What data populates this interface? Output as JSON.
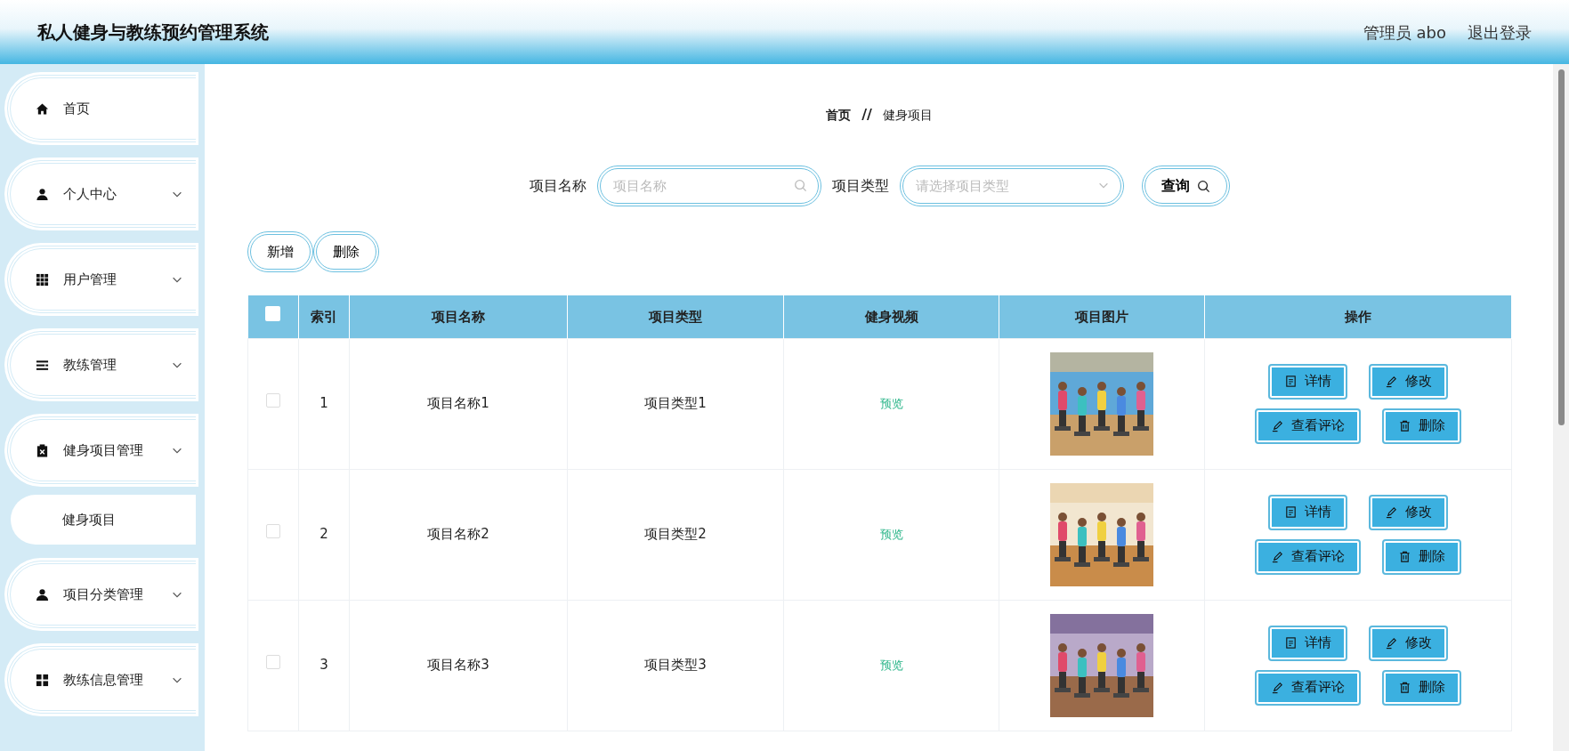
{
  "header": {
    "title": "私人健身与教练预约管理系统",
    "user": "管理员 abo",
    "logout": "退出登录"
  },
  "sidebar": {
    "items": [
      {
        "label": "首页",
        "kind": "link"
      },
      {
        "label": "个人中心",
        "kind": "submenu"
      },
      {
        "label": "用户管理",
        "kind": "submenu"
      },
      {
        "label": "教练管理",
        "kind": "submenu"
      },
      {
        "label": "健身项目管理",
        "kind": "submenu",
        "children": [
          {
            "label": "健身项目"
          }
        ]
      },
      {
        "label": "项目分类管理",
        "kind": "submenu"
      },
      {
        "label": "教练信息管理",
        "kind": "submenu"
      }
    ]
  },
  "breadcrumb": {
    "items": [
      "首页",
      "健身项目"
    ],
    "separator": "//"
  },
  "search": {
    "fields": [
      {
        "label": "项目名称",
        "placeholder": "项目名称",
        "kind": "text"
      },
      {
        "label": "项目类型",
        "placeholder": "请选择项目类型",
        "kind": "select"
      }
    ],
    "button": "查询"
  },
  "actions": [
    "新增",
    "删除"
  ],
  "table": {
    "select_all": {
      "checked": false
    },
    "columns": [
      "索引",
      "项目名称",
      "项目类型",
      "健身视频",
      "项目图片",
      "操作"
    ],
    "rows": [
      {
        "checked": false,
        "index": "1",
        "name": "项目名称1",
        "type": "项目类型1",
        "video": "预览",
        "buttons": [
          "详情",
          "修改",
          "查看评论",
          "删除"
        ]
      },
      {
        "checked": false,
        "index": "2",
        "name": "项目名称2",
        "type": "项目类型2",
        "video": "预览",
        "buttons": [
          "详情",
          "修改",
          "查看评论",
          "删除"
        ]
      },
      {
        "checked": false,
        "index": "3",
        "name": "项目名称3",
        "type": "项目类型3",
        "video": "预览",
        "buttons": [
          "详情",
          "修改",
          "查看评论",
          "删除"
        ]
      }
    ]
  }
}
